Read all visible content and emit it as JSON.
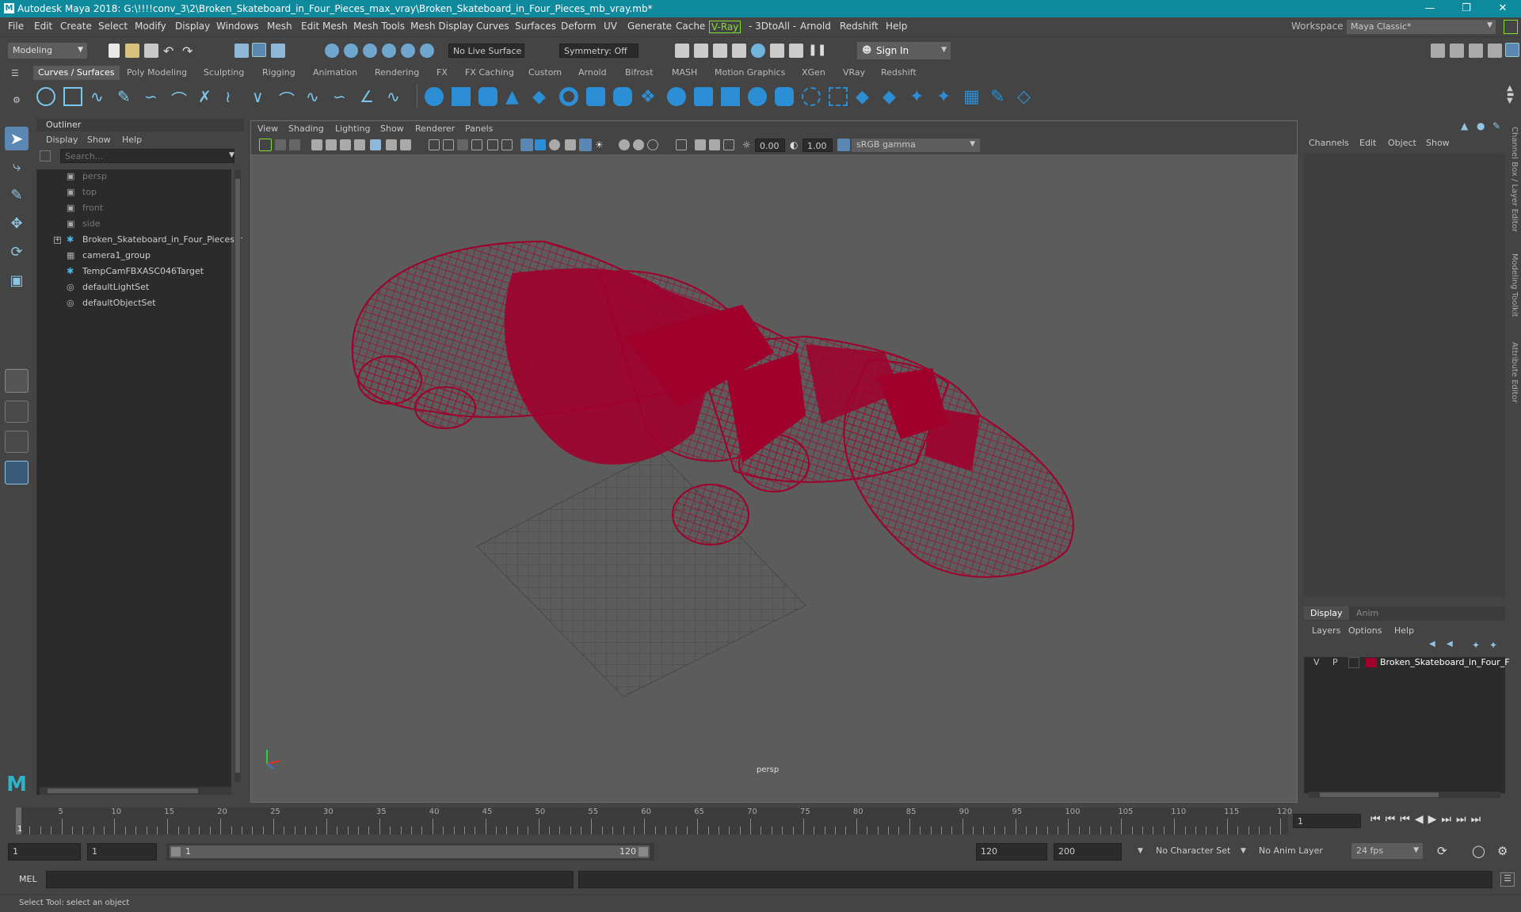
{
  "window": {
    "title": "Autodesk Maya 2018: G:\\!!!!conv_3\\2\\Broken_Skateboard_in_Four_Pieces_max_vray\\Broken_Skateboard_in_Four_Pieces_mb_vray.mb*",
    "logo": "M"
  },
  "menubar": {
    "items": [
      "File",
      "Edit",
      "Create",
      "Select",
      "Modify",
      "Display",
      "Windows",
      "Mesh",
      "Edit Mesh",
      "Mesh Tools",
      "Mesh Display",
      "Curves",
      "Surfaces",
      "Deform",
      "UV",
      "Generate",
      "Cache",
      "V-Ray",
      "- 3DtoAll -",
      "Arnold",
      "Redshift",
      "Help"
    ],
    "workspace_label": "Workspace :",
    "workspace_value": "Maya Classic*"
  },
  "statusline": {
    "mode": "Modeling",
    "live_surface": "No Live Surface",
    "symmetry": "Symmetry: Off",
    "sign_in": "Sign In"
  },
  "shelf": {
    "tabs": [
      "Curves / Surfaces",
      "Poly Modeling",
      "Sculpting",
      "Rigging",
      "Animation",
      "Rendering",
      "FX",
      "FX Caching",
      "Custom",
      "Arnold",
      "Bifrost",
      "MASH",
      "Motion Graphics",
      "XGen",
      "VRay",
      "Redshift"
    ],
    "active_tab": "Curves / Surfaces"
  },
  "outliner": {
    "title": "Outliner",
    "menu": [
      "Display",
      "Show",
      "Help"
    ],
    "search_placeholder": "Search...",
    "items": [
      {
        "label": "persp",
        "icon": "camera-icon",
        "dim": true
      },
      {
        "label": "top",
        "icon": "camera-icon",
        "dim": true
      },
      {
        "label": "front",
        "icon": "camera-icon",
        "dim": true
      },
      {
        "label": "side",
        "icon": "camera-icon",
        "dim": true
      },
      {
        "label": "Broken_Skateboard_in_Four_Pieces_r",
        "icon": "group-star-icon",
        "dim": false,
        "expandable": true
      },
      {
        "label": "camera1_group",
        "icon": "group-icon",
        "dim": false
      },
      {
        "label": "TempCamFBXASC046Target",
        "icon": "locator-icon",
        "dim": false
      },
      {
        "label": "defaultLightSet",
        "icon": "set-icon",
        "dim": false
      },
      {
        "label": "defaultObjectSet",
        "icon": "set-icon",
        "dim": false
      }
    ]
  },
  "viewport": {
    "menu": [
      "View",
      "Shading",
      "Lighting",
      "Show",
      "Renderer",
      "Panels"
    ],
    "near_value": "0.00",
    "far_value": "1.00",
    "color_space": "sRGB gamma",
    "camera_label": "persp",
    "wire_color": "#a0002c"
  },
  "channelbox": {
    "menu": [
      "Channels",
      "Edit",
      "Object",
      "Show"
    ],
    "side_tabs": [
      "Channel Box / Layer Editor",
      "Modeling Toolkit",
      "Attribute Editor"
    ]
  },
  "layers": {
    "tabs": [
      "Display",
      "Anim"
    ],
    "active_tab": "Display",
    "menu": [
      "Layers",
      "Options",
      "Help"
    ],
    "layer": {
      "visible": "V",
      "playback": "P",
      "name": "Broken_Skateboard_in_Four_F",
      "color": "#a0002c"
    }
  },
  "timeline": {
    "ticks": [
      "5",
      "10",
      "15",
      "20",
      "25",
      "30",
      "35",
      "40",
      "45",
      "50",
      "55",
      "60",
      "65",
      "70",
      "75",
      "80",
      "85",
      "90",
      "95",
      "100",
      "105",
      "110",
      "115",
      "120"
    ],
    "first_tick": "1",
    "current_frame": "1"
  },
  "range": {
    "start": "1",
    "anim_start": "1",
    "slider_start": "1",
    "slider_end": "120",
    "anim_end": "120",
    "end": "200",
    "character_set": "No Character Set",
    "anim_layer": "No Anim Layer",
    "fps": "24 fps"
  },
  "cmdline": {
    "label": "MEL"
  },
  "helpline": {
    "text": "Select Tool: select an object"
  }
}
